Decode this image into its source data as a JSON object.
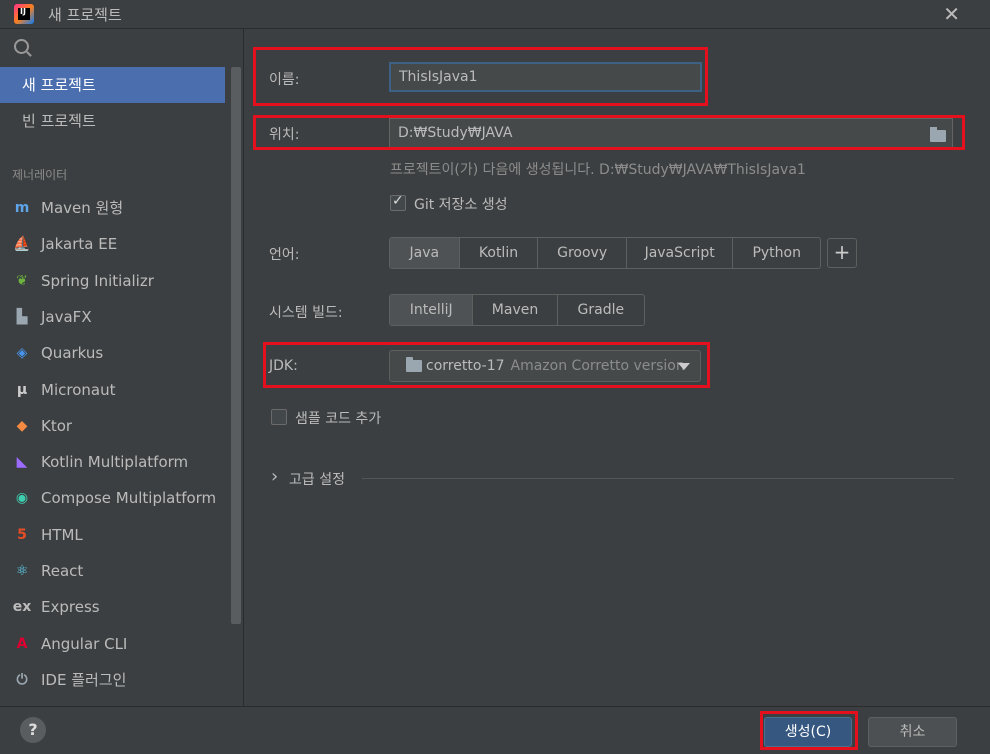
{
  "window": {
    "title": "새 프로젝트",
    "close": "✕"
  },
  "sidebar": {
    "items": [
      {
        "label": "새 프로젝트"
      },
      {
        "label": "빈 프로젝트"
      }
    ],
    "generators_label": "제너레이터",
    "generators": [
      {
        "label": "Maven 원형",
        "icon": "maven-icon",
        "glyph": "m",
        "color": "#5fa3e8"
      },
      {
        "label": "Jakarta EE",
        "icon": "jakarta-icon",
        "glyph": "⛵",
        "color": "#f0a030"
      },
      {
        "label": "Spring Initializr",
        "icon": "spring-icon",
        "glyph": "❦",
        "color": "#6db33f"
      },
      {
        "label": "JavaFX",
        "icon": "javafx-icon",
        "glyph": "▙",
        "color": "#9aa7b0"
      },
      {
        "label": "Quarkus",
        "icon": "quarkus-icon",
        "glyph": "◈",
        "color": "#4695eb"
      },
      {
        "label": "Micronaut",
        "icon": "micronaut-icon",
        "glyph": "μ",
        "color": "#cccccc"
      },
      {
        "label": "Ktor",
        "icon": "ktor-icon",
        "glyph": "◆",
        "color": "#f58a42"
      },
      {
        "label": "Kotlin Multiplatform",
        "icon": "kotlin-icon",
        "glyph": "◣",
        "color": "#9c6bff"
      },
      {
        "label": "Compose Multiplatform",
        "icon": "compose-icon",
        "glyph": "◉",
        "color": "#3ecfb0"
      },
      {
        "label": "HTML",
        "icon": "html-icon",
        "glyph": "5",
        "color": "#e44d26"
      },
      {
        "label": "React",
        "icon": "react-icon",
        "glyph": "⚛",
        "color": "#61dafb"
      },
      {
        "label": "Express",
        "icon": "express-icon",
        "glyph": "ex",
        "color": "#bbbbbb"
      },
      {
        "label": "Angular CLI",
        "icon": "angular-icon",
        "glyph": "A",
        "color": "#dd0031"
      },
      {
        "label": "IDE 플러그인",
        "icon": "plugin-icon",
        "glyph": "⏻",
        "color": "#9aa7b0"
      }
    ]
  },
  "form": {
    "name_label": "이름:",
    "name_value": "ThisIsJava1",
    "location_label": "위치:",
    "location_value": "D:₩Study₩JAVA",
    "location_hint": "프로젝트이(가) 다음에 생성됩니다. D:₩Study₩JAVA₩ThisIsJava1",
    "git_label": "Git 저장소 생성",
    "language_label": "언어:",
    "languages": [
      "Java",
      "Kotlin",
      "Groovy",
      "JavaScript",
      "Python"
    ],
    "language_selected": "Java",
    "add_language": "+",
    "build_label": "시스템 빌드:",
    "builds": [
      "IntelliJ",
      "Maven",
      "Gradle"
    ],
    "build_selected": "IntelliJ",
    "jdk_label": "JDK:",
    "jdk_name": "corretto-17",
    "jdk_detail": "Amazon Corretto version",
    "sample_label": "샘플 코드 추가",
    "advanced_label": "고급 설정",
    "advanced_chevron": "›"
  },
  "footer": {
    "help": "?",
    "create": "생성(C)",
    "cancel": "취소"
  },
  "colors": {
    "highlight": "#e5101e",
    "selected": "#4b6eaf",
    "primary": "#365880"
  }
}
